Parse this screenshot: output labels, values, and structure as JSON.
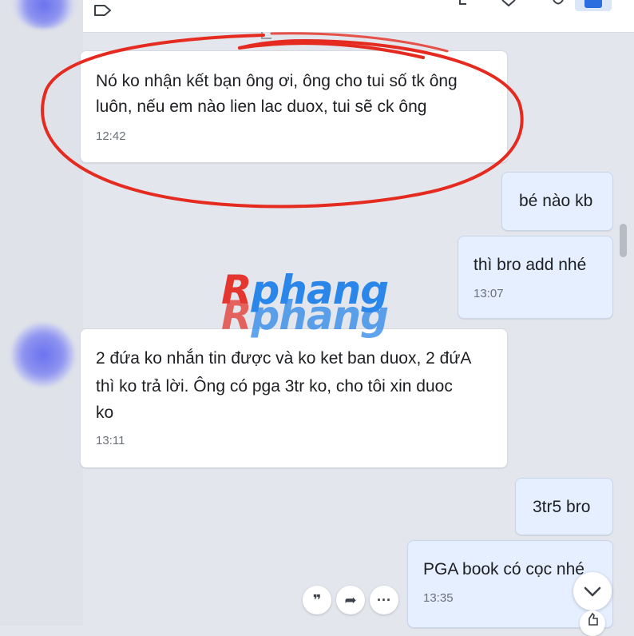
{
  "messages": [
    {
      "direction": "incoming",
      "lines": [
        "Nó ko nhận kết bạn ông ơi, ông cho tui số tk ông",
        "luôn, nếu em nào lien lac duox, tui sẽ ck ông"
      ],
      "time": "12:42"
    },
    {
      "direction": "outgoing",
      "lines": [
        "bé nào kb"
      ],
      "time": ""
    },
    {
      "direction": "outgoing",
      "lines": [
        "thì bro add nhé"
      ],
      "time": "13:07"
    },
    {
      "direction": "incoming",
      "lines": [
        "2 đứa ko nhắn tin được và ko ket ban duox, 2 đứA",
        "thì ko trả lời. Ông có pga 3tr ko, cho tôi xin duoc",
        "ko"
      ],
      "time": "13:11"
    },
    {
      "direction": "outgoing",
      "lines": [
        "3tr5 bro"
      ],
      "time": ""
    },
    {
      "direction": "outgoing",
      "lines": [
        "PGA book có cọc nhé"
      ],
      "time": "13:35"
    }
  ],
  "watermark": {
    "first_letter": "R",
    "rest": "phang"
  },
  "message_actions": {
    "quote_symbol": "❞",
    "forward_symbol": "➦",
    "more_symbol": "···"
  },
  "colors": {
    "incoming_bubble": "#ffffff",
    "outgoing_bubble": "#e5efff",
    "chat_background": "#e3e6ec",
    "annotation_red": "#e52a20"
  },
  "icons": [
    "tag-icon",
    "reply-icon",
    "quote-icon",
    "forward-icon",
    "more-icon",
    "chevron-down-icon",
    "like-icon"
  ]
}
